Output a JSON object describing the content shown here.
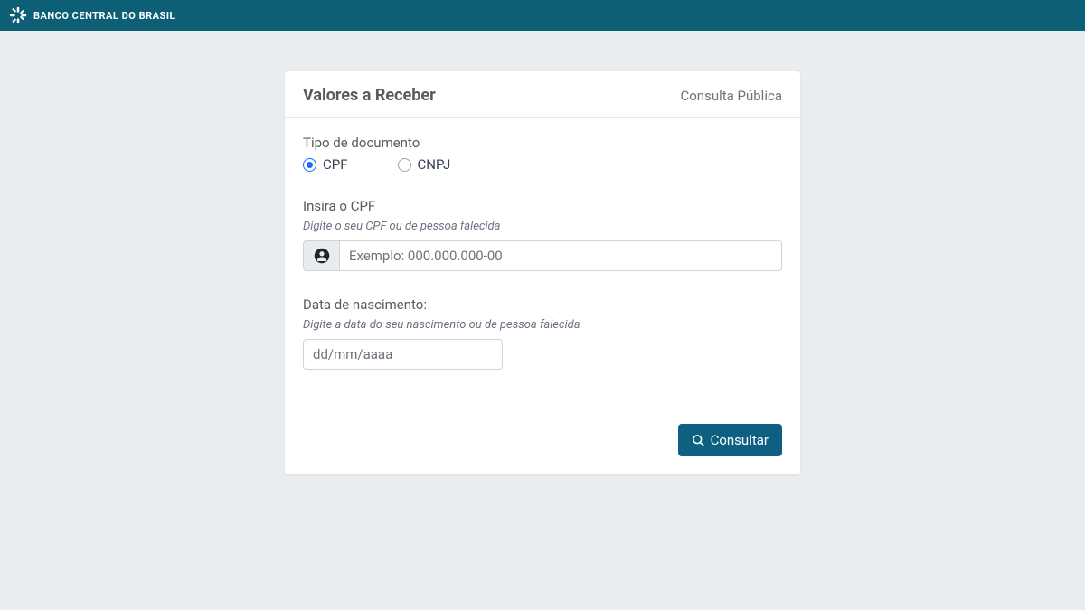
{
  "header": {
    "brand": "BANCO CENTRAL DO BRASIL"
  },
  "card": {
    "title": "Valores a Receber",
    "subtitle": "Consulta Pública"
  },
  "form": {
    "doc_type": {
      "label": "Tipo de documento",
      "options": {
        "cpf": "CPF",
        "cnpj": "CNPJ"
      },
      "selected": "cpf"
    },
    "cpf": {
      "label": "Insira o CPF",
      "hint": "Digite o seu CPF ou de pessoa falecida",
      "placeholder": "Exemplo: 000.000.000-00",
      "value": ""
    },
    "birthdate": {
      "label": "Data de nascimento:",
      "hint": "Digite a data do seu nascimento ou de pessoa falecida",
      "placeholder": "dd/mm/aaaa",
      "value": ""
    },
    "submit_label": "Consultar"
  },
  "colors": {
    "topbar": "#0d5f75",
    "primary_button": "#0d6080",
    "radio_selected": "#0d6efd",
    "background": "#eaedef"
  }
}
